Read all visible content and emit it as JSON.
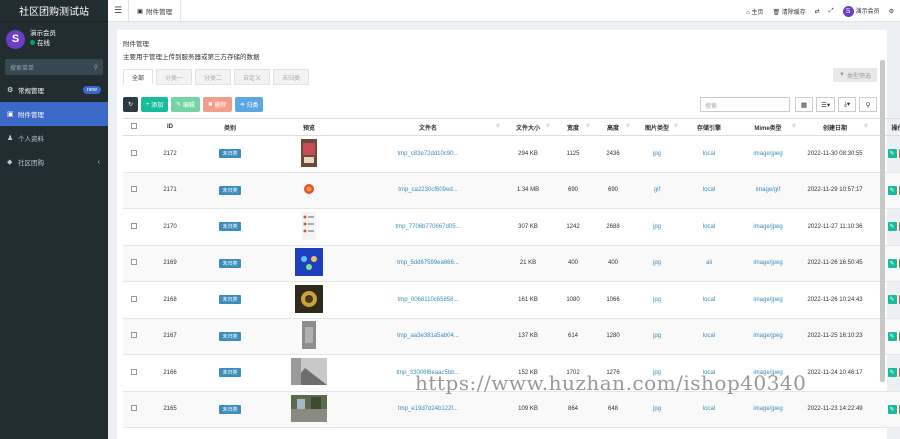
{
  "app": {
    "title": "社区团购测试站",
    "tab": "附件管理"
  },
  "user": {
    "name": "演示会员",
    "status": "在线",
    "avatar_letter": "S"
  },
  "sidebar": {
    "search_placeholder": "搜索菜单",
    "items": [
      {
        "label": "常规管理",
        "badge": "new"
      },
      {
        "label": "附件管理"
      },
      {
        "label": "个人资料"
      },
      {
        "label": "社区团购"
      }
    ]
  },
  "topbar": {
    "home": "主页",
    "clear_cache": "清除缓存",
    "user": "演示会员"
  },
  "panel": {
    "title": "附件管理",
    "description": "主要用于管理上传到服务器或第三方存储的数据",
    "tabs": [
      "全部",
      "分类一",
      "分类二",
      "自定义",
      "未归类"
    ],
    "filter_button": "类型筛选"
  },
  "toolbar": {
    "add": "添加",
    "edit": "编辑",
    "delete": "删除",
    "classify": "归类"
  },
  "search": {
    "placeholder": "搜索"
  },
  "table": {
    "headers": [
      "ID",
      "类别",
      "预览",
      "文件名",
      "文件大小",
      "宽度",
      "高度",
      "图片类型",
      "存储引擎",
      "Mime类型",
      "创建日期",
      "操作"
    ],
    "rows": [
      {
        "id": "2172",
        "category": "未归类",
        "filename": "tmp_c83e72dd10c90...",
        "size": "294 KB",
        "width": "1125",
        "height": "2436",
        "type": "jpg",
        "storage": "local",
        "mime": "image/jpeg",
        "date": "2022-11-30 08:30:55",
        "thumb": "phone"
      },
      {
        "id": "2171",
        "category": "未归类",
        "filename": "tmp_ca2230cf609ed...",
        "size": "1.34 MB",
        "width": "690",
        "height": "690",
        "type": "gif",
        "storage": "local",
        "mime": "image/gif",
        "date": "2022-11-29 10:57:17",
        "thumb": "gif"
      },
      {
        "id": "2170",
        "category": "未归类",
        "filename": "tmp_7706b770667d05...",
        "size": "307 KB",
        "width": "1242",
        "height": "2688",
        "type": "jpg",
        "storage": "local",
        "mime": "image/jpeg",
        "date": "2022-11-27 11:10:36",
        "thumb": "list"
      },
      {
        "id": "2169",
        "category": "未归类",
        "filename": "tmp_5dd67599ea666...",
        "size": "21 KB",
        "width": "400",
        "height": "400",
        "type": "jpg",
        "storage": "ali",
        "mime": "image/jpeg",
        "date": "2022-11-26 16:50:45",
        "thumb": "blue"
      },
      {
        "id": "2168",
        "category": "未归类",
        "filename": "tmp_0068110c65858...",
        "size": "161 KB",
        "width": "1080",
        "height": "1066",
        "type": "jpg",
        "storage": "local",
        "mime": "image/jpeg",
        "date": "2022-11-26 10:24:43",
        "thumb": "dark"
      },
      {
        "id": "2167",
        "category": "未归类",
        "filename": "tmp_aa3e381a5ab04...",
        "size": "137 KB",
        "width": "614",
        "height": "1280",
        "type": "jpg",
        "storage": "local",
        "mime": "image/jpeg",
        "date": "2022-11-25 16:10:23",
        "thumb": "gray"
      },
      {
        "id": "2166",
        "category": "未归类",
        "filename": "tmp_33006f6eaac5bb...",
        "size": "152 KB",
        "width": "1702",
        "height": "1276",
        "type": "jpg",
        "storage": "local",
        "mime": "image/jpeg",
        "date": "2022-11-24 10:46:17",
        "thumb": "wide"
      },
      {
        "id": "2165",
        "category": "未归类",
        "filename": "tmp_e19d7d24b122f...",
        "size": "109 KB",
        "width": "864",
        "height": "648",
        "type": "jpg",
        "storage": "local",
        "mime": "image/jpeg",
        "date": "2022-11-23 14:22:49",
        "thumb": "street"
      }
    ]
  },
  "watermark": "https://www.huzhan.com/ishop40340",
  "colors": {
    "accent": "#3c68c8",
    "green": "#18bc9c",
    "red": "#e74c3c",
    "sidebar": "#222d32"
  }
}
